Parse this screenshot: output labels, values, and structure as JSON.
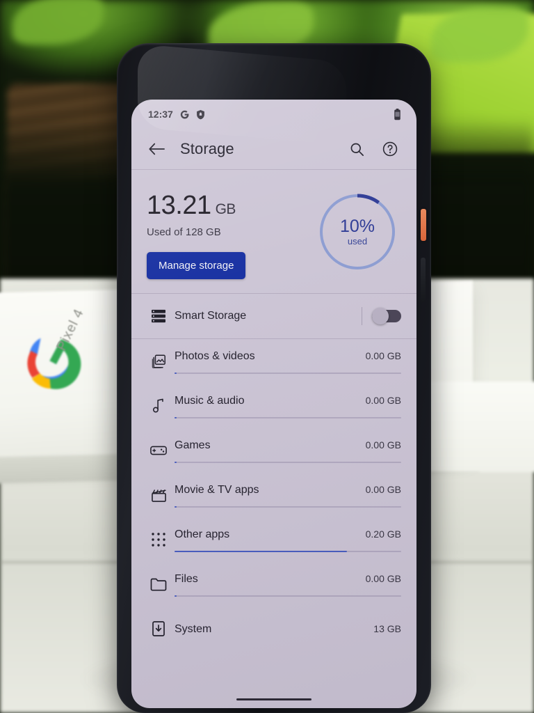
{
  "scene": {
    "product_box_label": "Pixel 4",
    "brand_logo": "google-g-logo"
  },
  "phone": {
    "power_button": "power-button",
    "volume_button": "volume-button",
    "earpiece": "earpiece-speaker"
  },
  "statusbar": {
    "time": "12:37",
    "icons": [
      "google-g-icon",
      "shield-icon",
      "battery-icon"
    ]
  },
  "appbar": {
    "back_label": "back-arrow",
    "title": "Storage",
    "search_label": "search-icon",
    "help_label": "help-icon"
  },
  "summary": {
    "used_value": "13.21",
    "used_unit": "GB",
    "used_of": "Used of 128 GB",
    "manage_button": "Manage storage",
    "gauge_percent": "10%",
    "gauge_caption": "used",
    "gauge_fraction": 10,
    "accent_button": "#1b33a3",
    "accent_ring": "#2f3c96",
    "ring_track": "#8e9ed2"
  },
  "smart_storage": {
    "label": "Smart Storage",
    "icon": "storage-list-icon",
    "toggle_on": false
  },
  "categories": [
    {
      "label": "Photos & videos",
      "value": "0.00 GB",
      "icon": "photo-stack-icon",
      "bar_pct": 1
    },
    {
      "label": "Music & audio",
      "value": "0.00 GB",
      "icon": "music-note-icon",
      "bar_pct": 1
    },
    {
      "label": "Games",
      "value": "0.00 GB",
      "icon": "gamepad-icon",
      "bar_pct": 1
    },
    {
      "label": "Movie & TV apps",
      "value": "0.00 GB",
      "icon": "clapperboard-icon",
      "bar_pct": 1
    },
    {
      "label": "Other apps",
      "value": "0.20 GB",
      "icon": "apps-grid-icon",
      "bar_pct": 76
    },
    {
      "label": "Files",
      "value": "0.00 GB",
      "icon": "folder-icon",
      "bar_pct": 1
    },
    {
      "label": "System",
      "value": "13 GB",
      "icon": "system-update-icon",
      "bar_pct": 0
    }
  ]
}
